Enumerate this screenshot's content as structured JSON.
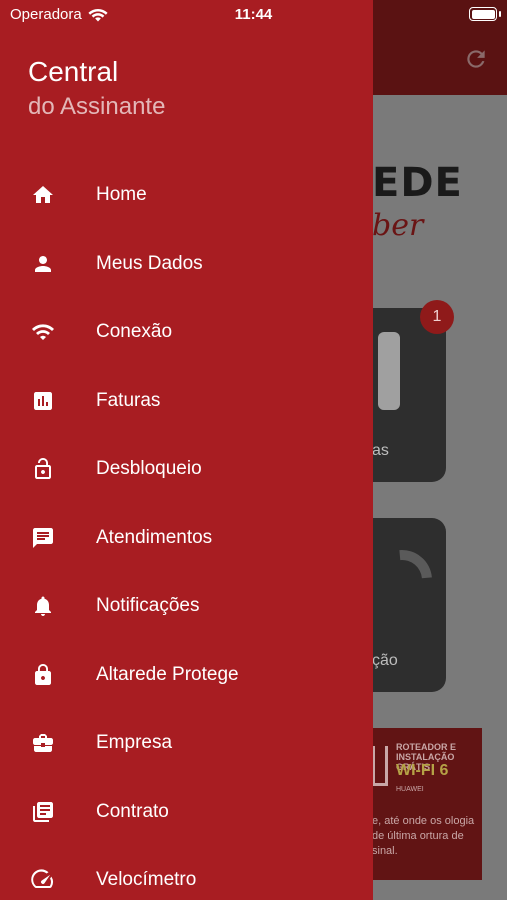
{
  "status_bar": {
    "carrier": "Operadora",
    "time": "11:44"
  },
  "drawer": {
    "title": "Central",
    "subtitle": "do Assinante",
    "items": [
      {
        "label": "Home",
        "icon": "home-icon"
      },
      {
        "label": "Meus Dados",
        "icon": "person-icon"
      },
      {
        "label": "Conexão",
        "icon": "wifi-icon"
      },
      {
        "label": "Faturas",
        "icon": "chart-icon"
      },
      {
        "label": "Desbloqueio",
        "icon": "unlock-icon"
      },
      {
        "label": "Atendimentos",
        "icon": "chat-icon"
      },
      {
        "label": "Notificações",
        "icon": "bell-icon"
      },
      {
        "label": "Altarede Protege",
        "icon": "lock-icon"
      },
      {
        "label": "Empresa",
        "icon": "briefcase-icon"
      },
      {
        "label": "Contrato",
        "icon": "document-icon"
      },
      {
        "label": "Velocímetro",
        "icon": "speedometer-icon"
      }
    ]
  },
  "background": {
    "logo_text": "EDE",
    "logo_swoosh": "ber",
    "badge_count": "1",
    "card_1_label": "as",
    "card_2_label": "ção",
    "banner": {
      "subtitle": "ROTEADOR E INSTALAÇÃO GRÁTIS",
      "title": "WI-FI 6",
      "brand": "HUAWEI",
      "text": "e, até onde os ologia de última ortura de sinal."
    }
  },
  "colors": {
    "drawer_bg": "#a81d22",
    "subtitle": "#e3b7b8",
    "overlay_bg": "#7a7a7a",
    "header_dim": "#5a1212"
  }
}
